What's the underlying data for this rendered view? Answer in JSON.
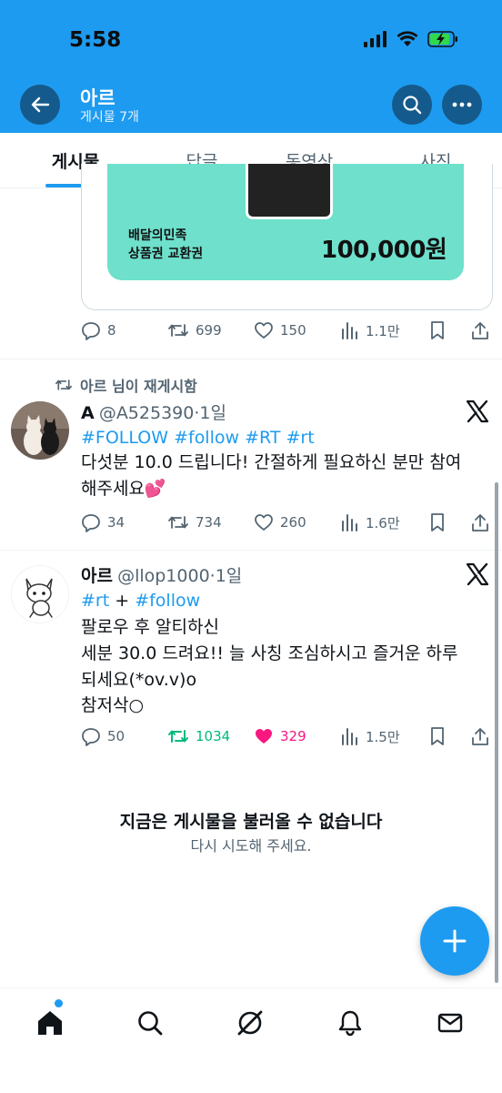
{
  "status_bar": {
    "time": "5:58"
  },
  "header": {
    "name": "아르",
    "subtitle": "게시물 7개",
    "accent_color": "#1d9bf0",
    "back_icon": "arrow-left-icon",
    "search_icon": "search-icon",
    "more_icon": "more-horizontal-icon"
  },
  "tabs": [
    {
      "label": "게시물",
      "active": true
    },
    {
      "label": "답글",
      "active": false
    },
    {
      "label": "동영상",
      "active": false
    },
    {
      "label": "사진",
      "active": false
    }
  ],
  "post1": {
    "voucher": {
      "line1": "배달의민족",
      "line2": "상품권 교환권",
      "amount": "100,000원",
      "color": "#6ee0cc"
    },
    "actions": {
      "replies": "8",
      "reposts": "699",
      "likes": "150",
      "views": "1.1만"
    }
  },
  "post2": {
    "repost_label": "아르 님이 재게시함",
    "name": "A",
    "handle": "@A525390",
    "time": "·1일",
    "hashtags": "#FOLLOW #follow #RT #rt",
    "line1": "다섯분 10.0 드립니다! 간절하게 필요하신 분만 참여",
    "line2": "해주세요💕",
    "actions": {
      "replies": "34",
      "reposts": "734",
      "likes": "260",
      "views": "1.6만"
    }
  },
  "post3": {
    "name": "아르",
    "handle": "@llop1000",
    "time": "·1일",
    "hashtag1": "#rt",
    "plus": " + ",
    "hashtag2": "#follow",
    "line1": "팔로우 후 알티하신",
    "line2": "세분 30.0 드려요!! 늘 사칭 조심하시고 즐거운 하루",
    "line3": "되세요(*ov.v)o",
    "line4": "참저삭○",
    "actions": {
      "replies": "50",
      "reposts": "1034",
      "likes": "329",
      "views": "1.5만"
    },
    "reposted": true,
    "liked": true
  },
  "empty_state": {
    "title": "지금은 게시물을 불러올 수 없습니다",
    "subtitle": "다시 시도해 주세요."
  },
  "bottom_nav": [
    "home-icon",
    "search-icon",
    "grok-icon",
    "notifications-icon",
    "messages-icon"
  ]
}
